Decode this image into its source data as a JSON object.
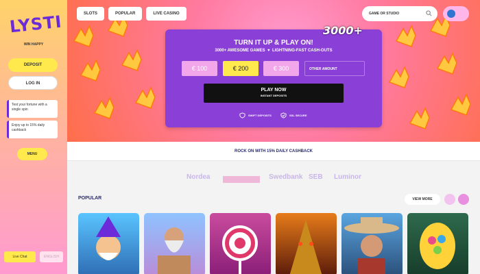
{
  "sidebar": {
    "logo": "LYSTI",
    "tagline": "WIN HAPPY",
    "deposit_label": "DEPOSIT",
    "login_label": "LOG IN",
    "promos": [
      {
        "text": "Test your fortune with a single spin"
      },
      {
        "text": "Enjoy up to 15% daily cashback"
      }
    ],
    "menu_label": "MENU",
    "livechat_label": "Live Chat",
    "language_label": "ENGLISH"
  },
  "topnav": {
    "tabs": [
      {
        "label": "SLOTS"
      },
      {
        "label": "POPULAR"
      },
      {
        "label": "LIVE CASINO"
      }
    ],
    "search_placeholder": "GAME OR STUDIO"
  },
  "hero": {
    "title": "TURN IT UP & PLAY ON!",
    "subtitle_left": "3000+ AWESOME GAMES",
    "subtitle_right": "LIGHTNING-FAST CASH-OUTS",
    "badge": "3000+",
    "amounts": [
      {
        "label": "€ 100",
        "color": "#f1a7ea"
      },
      {
        "label": "€ 200",
        "color": "#ffe94d"
      },
      {
        "label": "€ 300",
        "color": "#f1a7ea"
      }
    ],
    "other_amount_label": "OTHER AMOUNT",
    "play_label": "PLAY NOW",
    "play_sub": "INSTANT DEPOSITS",
    "trust": [
      {
        "label": "SWIFT DEPOSITS"
      },
      {
        "label": "SSL SECURE"
      }
    ]
  },
  "cashback_text": "ROCK ON WITH 15% DAILY CASHBACK",
  "payments": [
    "Nordea",
    "Swedbank",
    "SEB",
    "Luminor"
  ],
  "popular": {
    "title": "POPULAR",
    "view_more_label": "VIEW MORE",
    "tiles": [
      {
        "name": "wizard-game",
        "color": "#3aa8e8"
      },
      {
        "name": "zeus-game",
        "color": "#5f86c6"
      },
      {
        "name": "lollipop-game",
        "color": "#c94b9d"
      },
      {
        "name": "pharaoh-game",
        "color": "#c4500c"
      },
      {
        "name": "cowboy-game",
        "color": "#2d6fb3"
      },
      {
        "name": "egg-game",
        "color": "#2b5c3e"
      }
    ]
  },
  "colors": {
    "purple": "#8a3fd6",
    "yellow": "#ffe94d",
    "navy": "#2a2a6e"
  }
}
